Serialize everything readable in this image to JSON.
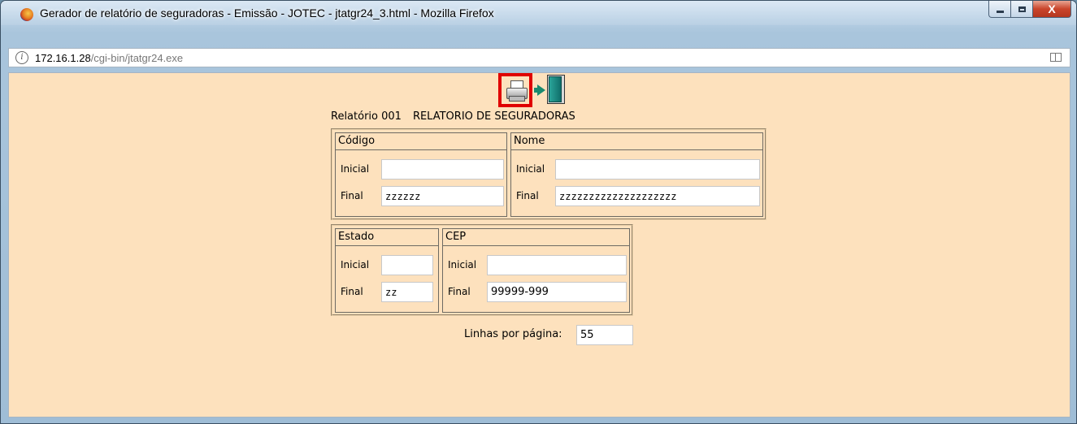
{
  "window": {
    "title": "Gerador de relatório de seguradoras - Emissão - JOTEC - jtatgr24_3.html - Mozilla Firefox",
    "close_label": "X"
  },
  "address": {
    "host": "172.16.1.28",
    "path": "/cgi-bin/jtatgr24.exe"
  },
  "toolbar": {
    "print_icon": "printer-icon",
    "exit_icon": "exit-door-icon"
  },
  "report": {
    "number_label": "Relatório 001",
    "name": "RELATORIO DE SEGURADORAS"
  },
  "groups": {
    "codigo": {
      "title": "Código",
      "inicial_label": "Inicial",
      "inicial_value": "",
      "final_label": "Final",
      "final_value": "zzzzzz"
    },
    "nome": {
      "title": "Nome",
      "inicial_label": "Inicial",
      "inicial_value": "",
      "final_label": "Final",
      "final_value": "zzzzzzzzzzzzzzzzzzzz"
    },
    "estado": {
      "title": "Estado",
      "inicial_label": "Inicial",
      "inicial_value": "",
      "final_label": "Final",
      "final_value": "zz"
    },
    "cep": {
      "title": "CEP",
      "inicial_label": "Inicial",
      "inicial_value": "",
      "final_label": "Final",
      "final_value": "99999-999"
    }
  },
  "lines_per_page": {
    "label": "Linhas por página:",
    "value": "55"
  },
  "colors": {
    "page_background": "#fde1bd",
    "highlight": "#e00000"
  }
}
